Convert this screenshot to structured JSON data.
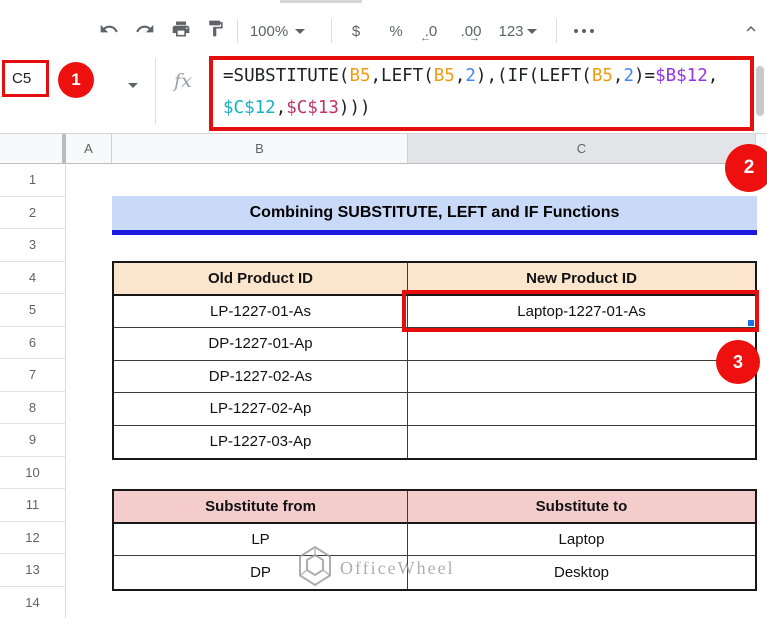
{
  "toolbar": {
    "zoom_value": "100%",
    "currency_label": "$",
    "percent_label": "%",
    "decrease_decimal_label": ".0",
    "decrease_decimal_arrow": "←",
    "increase_decimal_label": ".00",
    "increase_decimal_arrow": "→",
    "number_format_label": "123"
  },
  "formula_bar": {
    "name_box": "C5",
    "fx_label": "fx",
    "colors": {
      "default": "#202124",
      "orange": "#f09b13",
      "blue": "#4285f4",
      "purple": "#9334e6",
      "cyan": "#16b0c8",
      "crimson": "#c03365"
    },
    "lines": [
      [
        {
          "t": "=SUBSTITUTE(",
          "c": "default"
        },
        {
          "t": "B5",
          "c": "orange"
        },
        {
          "t": ",LEFT(",
          "c": "default"
        },
        {
          "t": "B5",
          "c": "orange"
        },
        {
          "t": ",",
          "c": "default"
        },
        {
          "t": "2",
          "c": "blue"
        },
        {
          "t": "),(IF(LEFT(",
          "c": "default"
        },
        {
          "t": "B5",
          "c": "orange"
        },
        {
          "t": ",",
          "c": "default"
        },
        {
          "t": "2",
          "c": "blue"
        },
        {
          "t": ")=",
          "c": "default"
        },
        {
          "t": "$B$12",
          "c": "purple"
        },
        {
          "t": ",",
          "c": "default"
        }
      ],
      [
        {
          "t": "$C$12",
          "c": "cyan"
        },
        {
          "t": ",",
          "c": "default"
        },
        {
          "t": "$C$13",
          "c": "crimson"
        },
        {
          "t": ")))",
          "c": "default"
        }
      ]
    ]
  },
  "annotations": {
    "badge_1": "1",
    "badge_2": "2",
    "badge_3": "3",
    "accent_red": "#e60d0d"
  },
  "grid": {
    "column_headers": [
      "A",
      "B",
      "C"
    ],
    "selected_column": "C",
    "row_count": 14,
    "selected_cell": "C5",
    "title": "Combining SUBSTITUTE, LEFT and IF Functions",
    "title_bg": "#c9daf8",
    "title_underline": "#1a1ae0",
    "table1": {
      "header_bg": "#fce5cd",
      "headers": [
        "Old Product ID",
        "New Product ID"
      ],
      "rows": [
        [
          "LP-1227-01-As",
          "Laptop-1227-01-As"
        ],
        [
          "DP-1227-01-Ap",
          ""
        ],
        [
          "DP-1227-02-As",
          ""
        ],
        [
          "LP-1227-02-Ap",
          ""
        ],
        [
          "LP-1227-03-Ap",
          ""
        ]
      ]
    },
    "table2": {
      "header_bg": "#f4cccc",
      "headers": [
        "Substitute from",
        "Substitute to"
      ],
      "rows": [
        [
          "LP",
          "Laptop"
        ],
        [
          "DP",
          "Desktop"
        ]
      ]
    }
  },
  "watermark": {
    "text": "OfficeWheel"
  }
}
